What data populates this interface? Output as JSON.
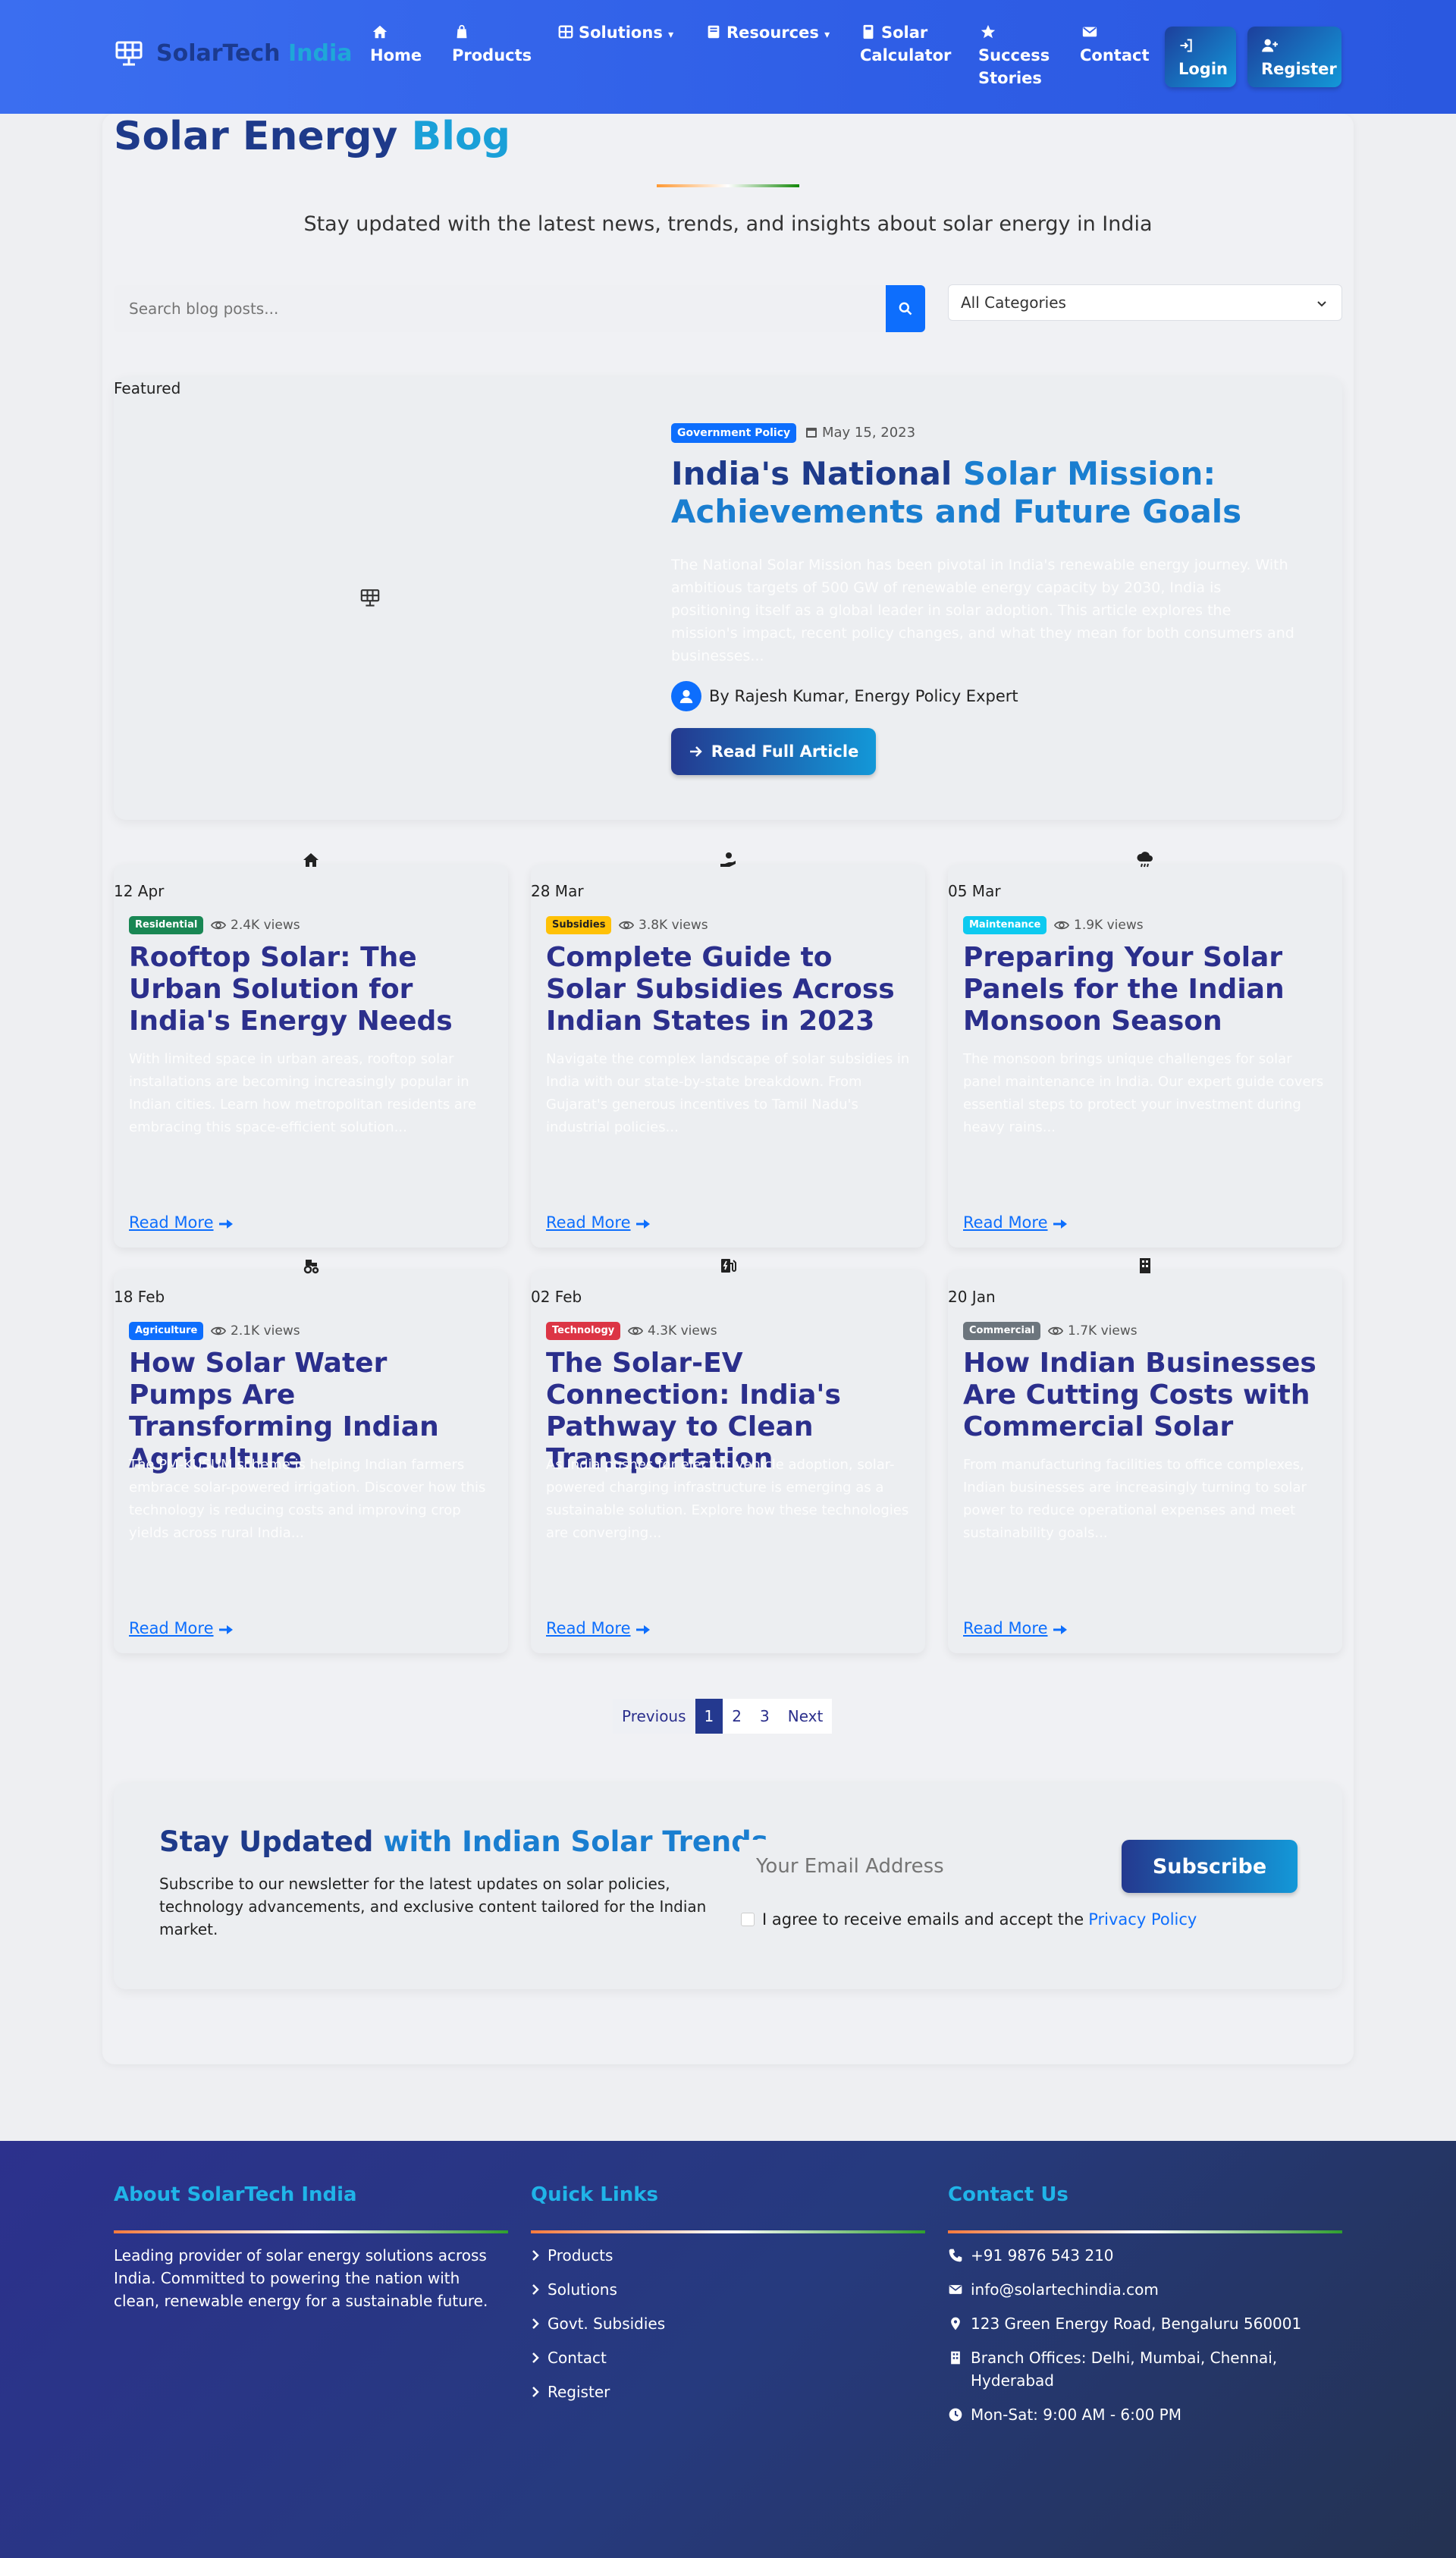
{
  "colors": {
    "primary": "#0d6efd",
    "navy": "#1e3a8a",
    "accent_blue": "#1aa0d8",
    "india_saffron": "#ff9933",
    "india_green": "#138808"
  },
  "nav": {
    "brand": {
      "part1": "SolarTech",
      "part2": "India",
      "icon": "solar-panel-icon"
    },
    "items": [
      {
        "label": "Home",
        "icon": "home-icon"
      },
      {
        "label": "Products",
        "icon": "bag-icon"
      },
      {
        "label": "Solutions",
        "icon": "grid-icon",
        "dropdown": true
      },
      {
        "label": "Resources",
        "icon": "book-icon",
        "dropdown": true
      },
      {
        "label": "Solar Calculator",
        "line1": "Solar",
        "line2": "Calculator",
        "icon": "calculator-icon"
      },
      {
        "label": "Success Stories",
        "line1": "Success",
        "line2": "Stories",
        "icon": "star-icon"
      },
      {
        "label": "Contact",
        "icon": "envelope-icon"
      }
    ],
    "login": "Login",
    "register": "Register"
  },
  "header": {
    "title_main": "Solar Energy",
    "title_accent": "Blog",
    "subtitle": "Stay updated with the latest news, trends, and insights about solar energy in India"
  },
  "search": {
    "placeholder": "Search blog posts...",
    "category_selected": "All Categories"
  },
  "featured": {
    "label": "Featured",
    "badge": "Government Policy",
    "date": "May 15, 2023",
    "title_part1": "India's National ",
    "title_accent": "Solar Mission:",
    "title_part2": " Achievements and Future Goals",
    "excerpt": "The National Solar Mission has been pivotal in India's renewable energy journey. With ambitious targets of 500 GW of renewable energy capacity by 2030, India is positioning itself as a global leader in solar adoption. This article explores the mission's impact, recent policy changes, and what they mean for both consumers and businesses...",
    "author": "By Rajesh Kumar, Energy Policy Expert",
    "button": "Read Full Article"
  },
  "posts": [
    {
      "icon": "home-icon",
      "date": "12 Apr",
      "badge": "Residential",
      "badge_color": "#198754",
      "views": "2.4K views",
      "title": "Rooftop Solar: The Urban Solution for India's Energy Needs",
      "excerpt": "With limited space in urban areas, rooftop solar installations are becoming increasingly popular in Indian cities. Learn how metropolitan residents are embracing this space-efficient solution...",
      "link": "Read More"
    },
    {
      "icon": "hand-coin-icon",
      "date": "28 Mar",
      "badge": "Subsidies",
      "badge_color": "#ffc107",
      "views": "3.8K views",
      "title": "Complete Guide to Solar Subsidies Across Indian States in 2023",
      "excerpt": "Navigate the complex landscape of solar subsidies in India with our state-by-state breakdown. From Gujarat's generous incentives to Tamil Nadu's industrial policies...",
      "link": "Read More"
    },
    {
      "icon": "cloud-rain-icon",
      "date": "05 Mar",
      "badge": "Maintenance",
      "badge_color": "#0dcaf0",
      "views": "1.9K views",
      "title": "Preparing Your Solar Panels for the Indian Monsoon Season",
      "excerpt": "The monsoon brings unique challenges for solar panel maintenance in India. Our expert guide covers essential steps to protect your investment during heavy rains...",
      "link": "Read More"
    },
    {
      "icon": "tractor-icon",
      "date": "18 Feb",
      "badge": "Agriculture",
      "badge_color": "#0d6efd",
      "views": "2.1K views",
      "title": "How Solar Water Pumps Are Transforming Indian Agriculture",
      "excerpt": "The PM-KUSUM scheme is helping Indian farmers embrace solar-powered irrigation. Discover how this technology is reducing costs and improving crop yields across rural India...",
      "link": "Read More"
    },
    {
      "icon": "charging-station-icon",
      "date": "02 Feb",
      "badge": "Technology",
      "badge_color": "#dc3545",
      "views": "4.3K views",
      "title": "The Solar-EV Connection: India's Pathway to Clean Transportation",
      "excerpt": "As India pushes for electric vehicle adoption, solar-powered charging infrastructure is emerging as a sustainable solution. Explore how these technologies are converging...",
      "link": "Read More"
    },
    {
      "icon": "building-icon",
      "date": "20 Jan",
      "badge": "Commercial",
      "badge_color": "#6c757d",
      "views": "1.7K views",
      "title": "How Indian Businesses Are Cutting Costs with Commercial Solar",
      "excerpt": "From manufacturing facilities to office complexes, Indian businesses are increasingly turning to solar power to reduce operational expenses and meet sustainability goals...",
      "link": "Read More"
    }
  ],
  "pagination": {
    "previous": "Previous",
    "pages": [
      "1",
      "2",
      "3"
    ],
    "active": "1",
    "next": "Next"
  },
  "newsletter": {
    "title_main": "Stay Updated",
    "title_accent": "with Indian Solar Trends",
    "text": "Subscribe to our newsletter for the latest updates on solar policies, technology advancements, and exclusive content tailored for the Indian market.",
    "email_placeholder": "Your Email Address",
    "button": "Subscribe",
    "consent_text": "I agree to receive emails and accept the",
    "consent_link": "Privacy Policy"
  },
  "footer": {
    "about": {
      "heading": "About SolarTech India",
      "text": "Leading provider of solar energy solutions across India. Committed to powering the nation with clean, renewable energy for a sustainable future."
    },
    "quick_links": {
      "heading": "Quick Links",
      "links": [
        "Products",
        "Solutions",
        "Govt. Subsidies",
        "Contact",
        "Register"
      ]
    },
    "contact": {
      "heading": "Contact Us",
      "phone": "+91 9876 543 210",
      "email": "info@solartechindia.com",
      "address": "123 Green Energy Road, Bengaluru 560001",
      "branches": "Branch Offices: Delhi, Mumbai, Chennai, Hyderabad",
      "hours": "Mon-Sat: 9:00 AM - 6:00 PM"
    }
  }
}
